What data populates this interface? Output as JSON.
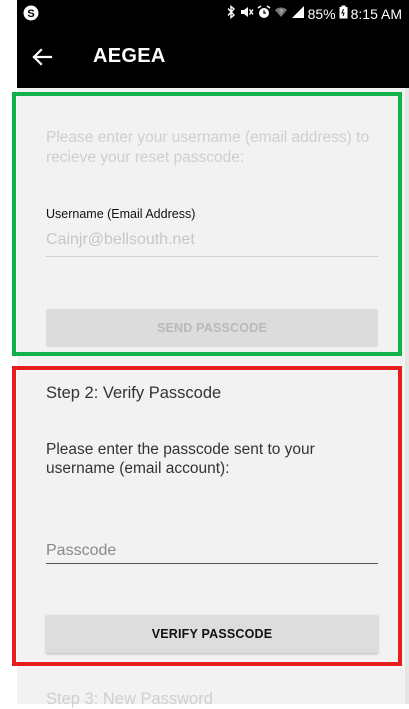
{
  "status_bar": {
    "icons": [
      "skype-icon",
      "bluetooth-icon",
      "mute-icon",
      "alarm-icon",
      "wifi-icon",
      "signal-icon",
      "battery-icon"
    ],
    "battery": "85%",
    "time": "8:15 AM"
  },
  "app_bar": {
    "back_icon": "arrow-left-icon",
    "title": "AEGEA"
  },
  "step1": {
    "instructions": "Please enter your username (email address) to recieve your reset passcode:",
    "username_label": "Username (Email Address)",
    "username_value": "Cainjr@bellsouth.net",
    "send_button": "SEND PASSCODE"
  },
  "step2": {
    "title": "Step 2: Verify Passcode",
    "instructions": "Please enter the passcode sent to your username (email account):",
    "passcode_placeholder": "Passcode",
    "verify_button": "VERIFY PASSCODE"
  },
  "step3": {
    "title": "Step 3: New Password"
  },
  "colors": {
    "highlight_green": "#12b24b",
    "highlight_red": "#e61e1e",
    "app_bar": "#000000"
  }
}
